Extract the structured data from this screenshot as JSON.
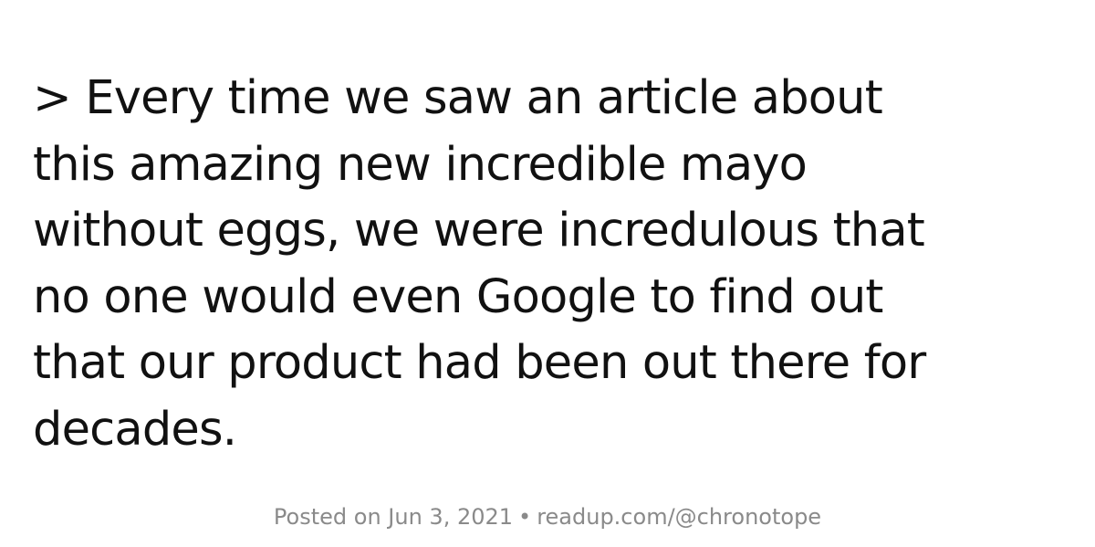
{
  "quote": {
    "lines": [
      "> Every time we saw an article about",
      "this amazing new incredible mayo",
      "without eggs, we were incredulous that",
      "no one would even Google to find out",
      "that our product had been out there for",
      "decades."
    ]
  },
  "footer": {
    "posted": "Posted on Jun 3, 2021",
    "separator": "•",
    "link": "readup.com/@chronotope"
  },
  "colors": {
    "background": "#ffffff",
    "text": "#111111",
    "footer_text": "#8a8a8a"
  }
}
